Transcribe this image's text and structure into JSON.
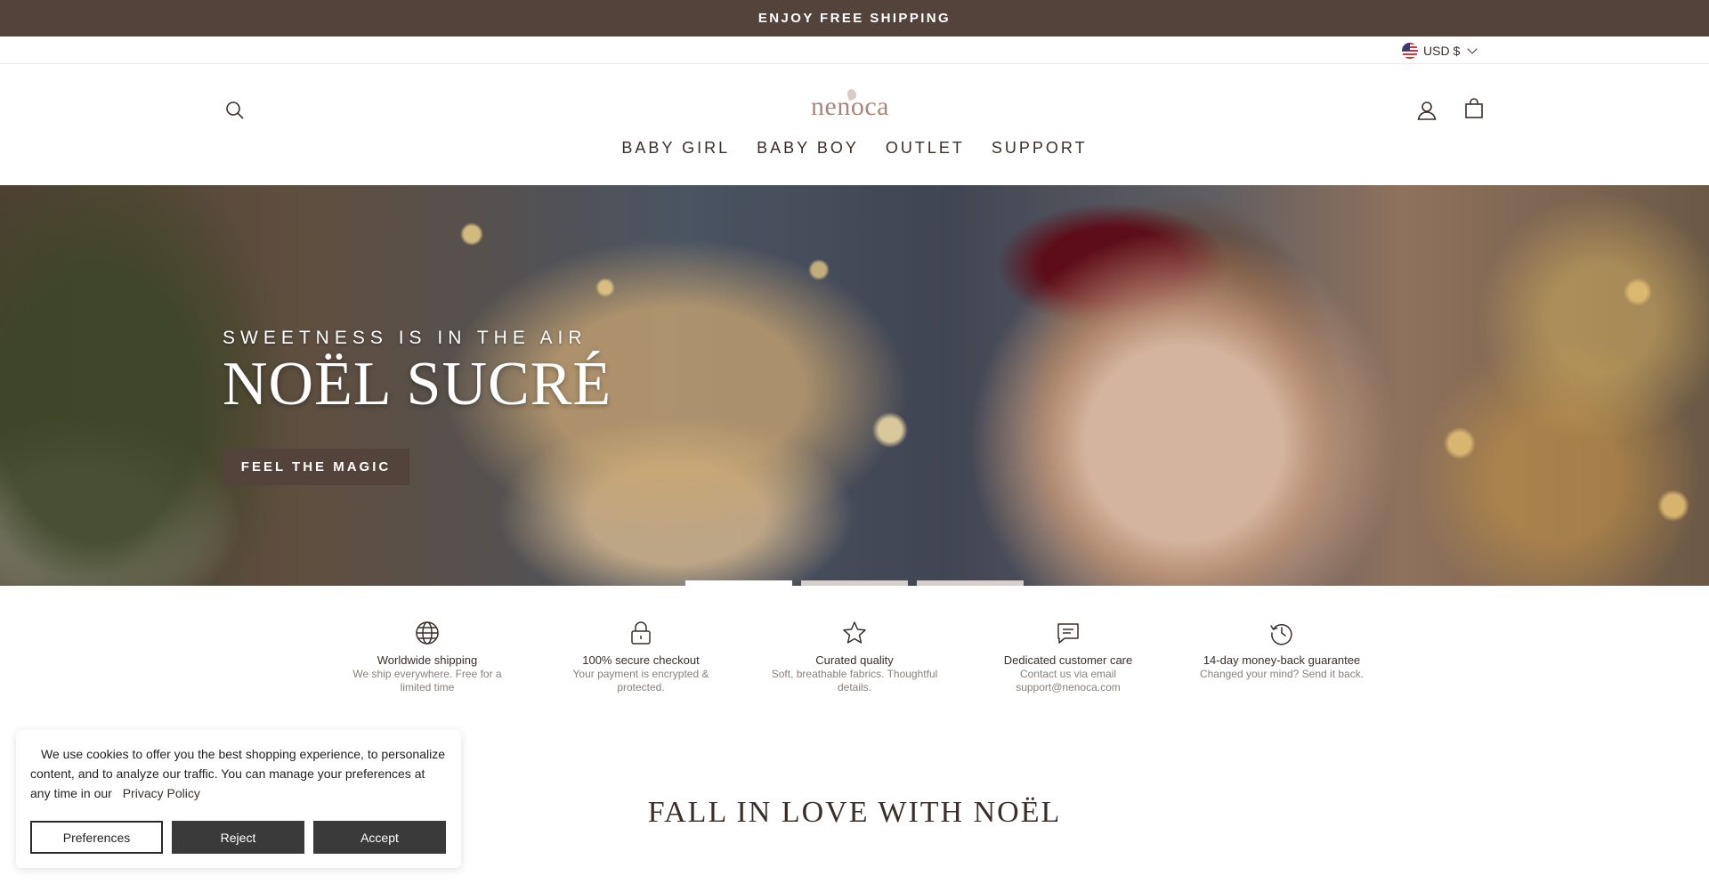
{
  "announcement": {
    "text": "ENJOY FREE SHIPPING"
  },
  "utility": {
    "currency": "USD $",
    "currency_flag": "us-flag-icon"
  },
  "header": {
    "logo_text": "nenoca",
    "nav": [
      {
        "label": "BABY GIRL"
      },
      {
        "label": "BABY BOY"
      },
      {
        "label": "OUTLET"
      },
      {
        "label": "SUPPORT"
      }
    ],
    "icons": [
      "search-icon",
      "account-icon",
      "cart-icon"
    ]
  },
  "hero": {
    "eyebrow": "SWEETNESS IS IN THE AIR",
    "title": "NOËL SUCRÉ",
    "cta_label": "FEEL THE MAGIC",
    "slide_count": 3,
    "active_slide": 1
  },
  "features": [
    {
      "icon": "globe-icon",
      "title": "Worldwide shipping",
      "desc": "We ship everywhere. Free for a limited time"
    },
    {
      "icon": "lock-icon",
      "title": "100% secure checkout",
      "desc": "Your payment is encrypted & protected."
    },
    {
      "icon": "star-icon",
      "title": "Curated quality",
      "desc": "Soft, breathable fabrics. Thoughtful details."
    },
    {
      "icon": "chat-icon",
      "title": "Dedicated customer care",
      "desc": "Contact us via email support@nenoca.com"
    },
    {
      "icon": "history-icon",
      "title": "14-day money-back guarantee",
      "desc": "Changed your mind? Send it back."
    }
  ],
  "cookie": {
    "text_line1": "We use cookies to offer you the best shopping experience, to personalize content, and to analyze our traffic. You can manage your preferences at",
    "text_line2": "any time in our",
    "link": "Privacy Policy",
    "buttons": {
      "preferences": "Preferences",
      "reject": "Reject",
      "accept": "Accept"
    }
  },
  "section": {
    "title": "FALL IN LOVE WITH NOËL"
  },
  "colors": {
    "brand_brown": "#54433b",
    "text": "#3a2e29",
    "logo": "#a8877a"
  }
}
